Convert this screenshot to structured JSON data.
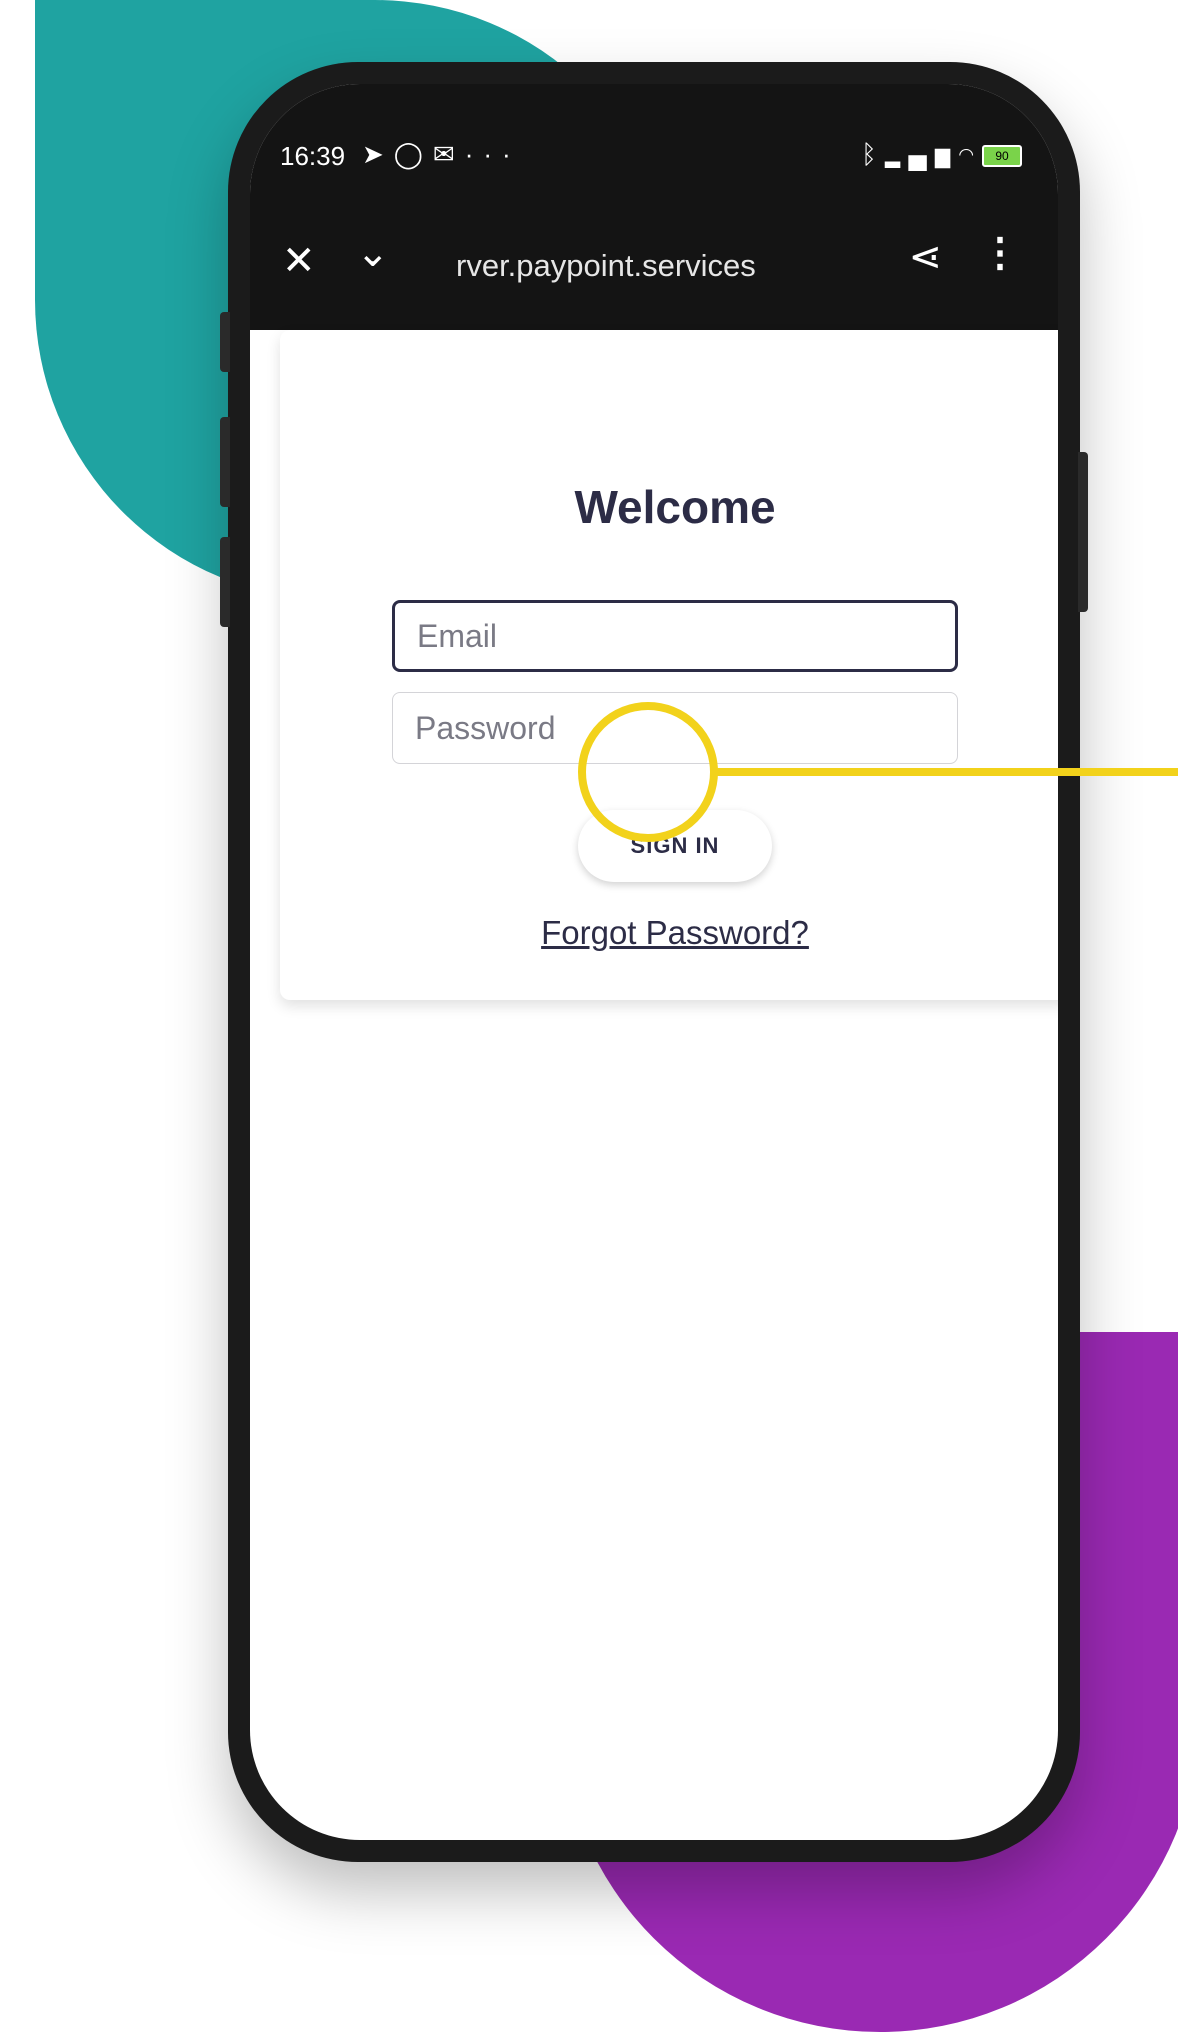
{
  "colors": {
    "teal_blob": "#1fa3a1",
    "purple_blob": "#9a29b3",
    "callout": "#f2d21b",
    "text_dark": "#2c2c46",
    "browser_bar": "#141414"
  },
  "status_bar": {
    "time": "16:39",
    "left_icons": [
      "telegram-icon",
      "whatsapp-icon",
      "message-icon",
      "more-icon"
    ],
    "more": "···",
    "right_icons": [
      "bluetooth-icon",
      "signal-icon",
      "wifi-icon",
      "battery-icon"
    ],
    "battery_level": "90"
  },
  "browser": {
    "url": "rver.paypoint.services",
    "close_icon": "close-icon",
    "collapse_icon": "chevron-down-icon",
    "share_icon": "share-icon",
    "menu_icon": "more-vertical-icon"
  },
  "login": {
    "title": "Welcome",
    "email_placeholder": "Email",
    "email_value": "",
    "password_placeholder": "Password",
    "password_value": "",
    "sign_in_label": "SIGN IN",
    "forgot_password_label": "Forgot Password?"
  }
}
